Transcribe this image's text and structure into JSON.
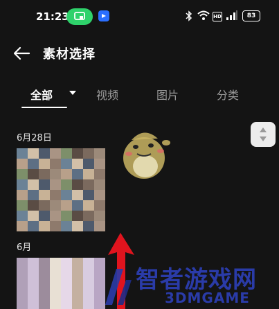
{
  "status_bar": {
    "time": "21:23",
    "hd_label": "HD",
    "signal_label": "4G",
    "battery": "83"
  },
  "header": {
    "title": "素材选择"
  },
  "tabs": [
    {
      "label": "全部",
      "active": true
    },
    {
      "label": "视频",
      "active": false
    },
    {
      "label": "图片",
      "active": false
    },
    {
      "label": "分类",
      "active": false
    }
  ],
  "sections": [
    {
      "date": "6月28日"
    },
    {
      "date": "6月"
    }
  ],
  "watermark": {
    "brand_cn": "智者游戏网",
    "brand_en": "3DMGAME"
  },
  "colors": {
    "background": "#141414",
    "cast_pill": "#2fd26b",
    "arrow": "#e0141e",
    "watermark": "#2a3ba8"
  }
}
